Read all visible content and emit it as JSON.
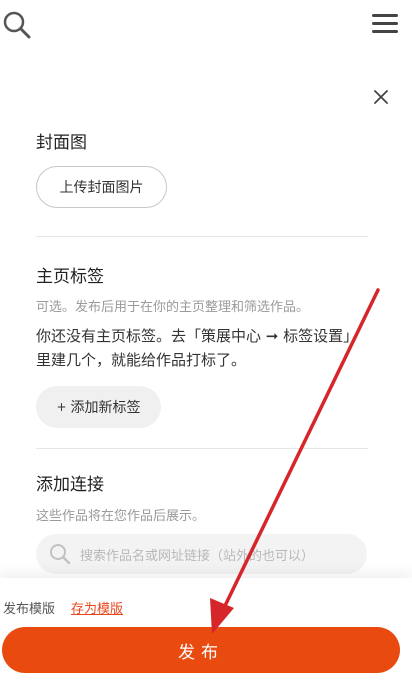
{
  "icons": {
    "top_search": "search-icon",
    "menu": "menu-icon",
    "close": "close-icon",
    "input_search": "search-icon"
  },
  "cover": {
    "title": "封面图",
    "upload_button": "上传封面图片"
  },
  "tags": {
    "title": "主页标签",
    "hint": "可选。发布后用于在你的主页整理和筛选作品。",
    "empty_text": "你还没有主页标签。去「策展中心 ➞ 标签设置」里建几个，就能给作品打标了。",
    "add_button_plus": "+",
    "add_button": "添加新标签"
  },
  "links": {
    "title": "添加连接",
    "hint": "这些作品将在您作品后展示。",
    "search_placeholder": "搜索作品名或网址链接（站外的也可以）"
  },
  "footer": {
    "template_label": "发布模版",
    "save_template": "存为模版",
    "publish": "发布"
  },
  "colors": {
    "accent": "#e94a0f",
    "link": "#e8481e",
    "annotation_arrow": "#d6262a"
  }
}
